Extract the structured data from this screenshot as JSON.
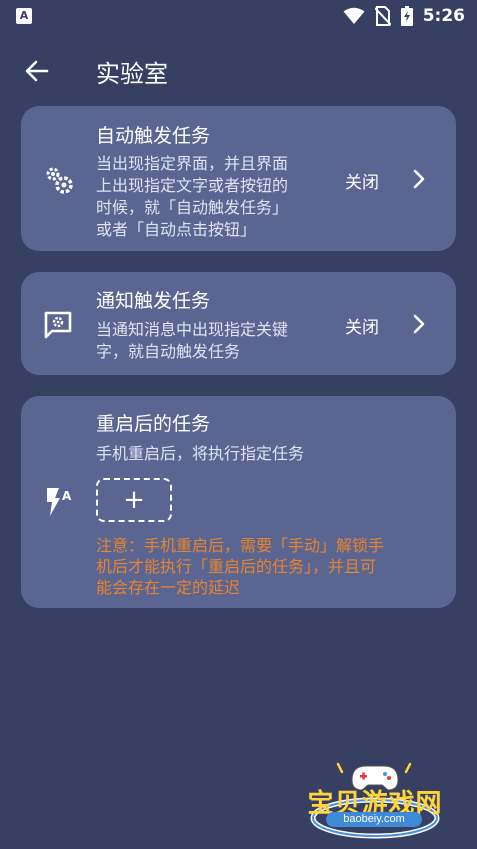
{
  "status_bar": {
    "app_indicator": "A",
    "time": "5:26",
    "icons": [
      "wifi-icon",
      "no-sim-icon",
      "battery-charging-icon"
    ]
  },
  "app_bar": {
    "back_icon": "arrow-left-icon",
    "title": "实验室"
  },
  "cards": [
    {
      "icon": "gears-icon",
      "title": "自动触发任务",
      "description": "当出现指定界面，并且界面上出现指定文字或者按钮的时候，就「自动触发任务」或者「自动点击按钮」",
      "desc_lines": [
        "当出现指定界面，并且界面",
        "上出现指定文字或者按钮的",
        "时候，就「自动触发任务」",
        "或者「自动点击按钮」"
      ],
      "state": "关闭",
      "chevron_icon": "chevron-right-icon"
    },
    {
      "icon": "notification-gear-icon",
      "title": "通知触发任务",
      "description": "当通知消息中出现指定关键字，就自动触发任务",
      "desc_lines": [
        "当通知消息中出现指定关键",
        "字，就自动触发任务"
      ],
      "state": "关闭",
      "chevron_icon": "chevron-right-icon"
    },
    {
      "icon": "flash-auto-icon",
      "title": "重启后的任务",
      "description": "手机重启后，将执行指定任务",
      "add_button_label": "+",
      "warning": "注意：手机重启后，需要「手动」解锁手机后才能执行「重启后的任务」，并且可能会存在一定的延迟",
      "warning_lines": [
        "注意：手机重启后，需要「手动」解锁手",
        "机后才能执行「重启后的任务」，并且可",
        "能会存在一定的延迟"
      ]
    }
  ],
  "watermark": {
    "text": "宝贝游戏网",
    "url": "baobeiy.com"
  },
  "colors": {
    "background": "#373f63",
    "card": "#5b6591",
    "warning": "#e7842f"
  }
}
